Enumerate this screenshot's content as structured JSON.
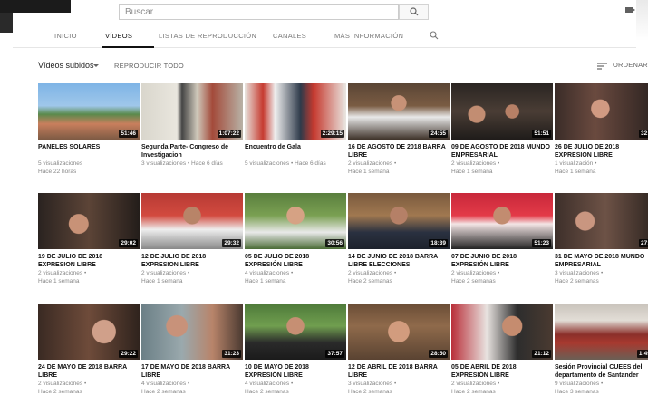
{
  "header": {
    "search_placeholder": "Buscar"
  },
  "tabs": [
    {
      "label": "INICIO",
      "active": false
    },
    {
      "label": "VÍDEOS",
      "active": true
    },
    {
      "label": "LISTAS DE REPRODUCCIÓN",
      "active": false
    },
    {
      "label": "CANALES",
      "active": false
    },
    {
      "label": "MÁS INFORMACIÓN",
      "active": false
    }
  ],
  "subbar": {
    "filter_label": "Vídeos subidos",
    "play_all_label": "REPRODUCIR TODO",
    "sort_label": "ORDENAR"
  },
  "videos": [
    {
      "title": "PANELES SOLARES",
      "views": "5 visualizaciones",
      "age": "Hace 22 horas",
      "duration": "51:46"
    },
    {
      "title": "Segunda Parte- Congreso de Investigacion",
      "views": "3 visualizaciones",
      "age": "Hace 6 días",
      "duration": "1:07:22"
    },
    {
      "title": "Encuentro de Gala",
      "views": "5 visualizaciones",
      "age": "Hace 6 días",
      "duration": "2:29:15"
    },
    {
      "title": "16 DE AGOSTO DE 2018 BARRA LIBRE",
      "views": "2 visualizaciones",
      "age": "Hace 1 semana",
      "duration": "24:55"
    },
    {
      "title": "09 DE AGOSTO DE 2018 MUNDO EMPRESARIAL",
      "views": "2 visualizaciones",
      "age": "Hace 1 semana",
      "duration": "51:51"
    },
    {
      "title": "26 DE JULIO DE 2018 EXPRESION LIBRE",
      "views": "1 visualización",
      "age": "Hace 1 semana",
      "duration": "32:3"
    },
    {
      "title": "19 DE JULIO DE 2018 EXPRESION LIBRE",
      "views": "2 visualizaciones",
      "age": "Hace 1 semana",
      "duration": "29:02"
    },
    {
      "title": "12 DE JULIO DE 2018 EXPRESION LIBRE",
      "views": "2 visualizaciones",
      "age": "Hace 1 semana",
      "duration": "29:32"
    },
    {
      "title": "05 DE JULIO DE 2018 EXPRESIÓN LIBRE",
      "views": "4 visualizaciones",
      "age": "Hace 1 semana",
      "duration": "30:56"
    },
    {
      "title": "14 DE JUNIO DE 2018 BARRA LIBRE ELECCIONES",
      "views": "2 visualizaciones",
      "age": "Hace 2 semanas",
      "duration": "18:39"
    },
    {
      "title": "07 DE JUNIO DE 2018 EXPRESIÓN LIBRE",
      "views": "2 visualizaciones",
      "age": "Hace 2 semanas",
      "duration": "51:23"
    },
    {
      "title": "31 DE MAYO DE 2018 MUNDO EMPRESARIAL",
      "views": "3 visualizaciones",
      "age": "Hace 2 semanas",
      "duration": "27:1"
    },
    {
      "title": "24 DE MAYO DE 2018 BARRA LIBRE",
      "views": "2 visualizaciones",
      "age": "Hace 2 semanas",
      "duration": "29:22"
    },
    {
      "title": "17 DE MAYO DE 2018 BARRA LIBRE",
      "views": "4 visualizaciones",
      "age": "Hace 2 semanas",
      "duration": "31:23"
    },
    {
      "title": "10 DE MAYO DE 2018 EXPRESIÓN LIBRE",
      "views": "4 visualizaciones",
      "age": "Hace 2 semanas",
      "duration": "37:57"
    },
    {
      "title": "12 DE ABRIL DE 2018 BARRA LIBRE",
      "views": "3 visualizaciones",
      "age": "Hace 2 semanas",
      "duration": "28:50"
    },
    {
      "title": "05 DE ABRIL DE 2018 EXPRESIÓN LIBRE",
      "views": "2 visualizaciones",
      "age": "Hace 2 semanas",
      "duration": "21:12"
    },
    {
      "title": "Sesión Provincial CUEES del departamento de Santander",
      "views": "9 visualizaciones",
      "age": "Hace 3 semanas",
      "duration": "1:49:"
    }
  ],
  "colors": {
    "accent": "#111111",
    "muted": "#888888"
  }
}
